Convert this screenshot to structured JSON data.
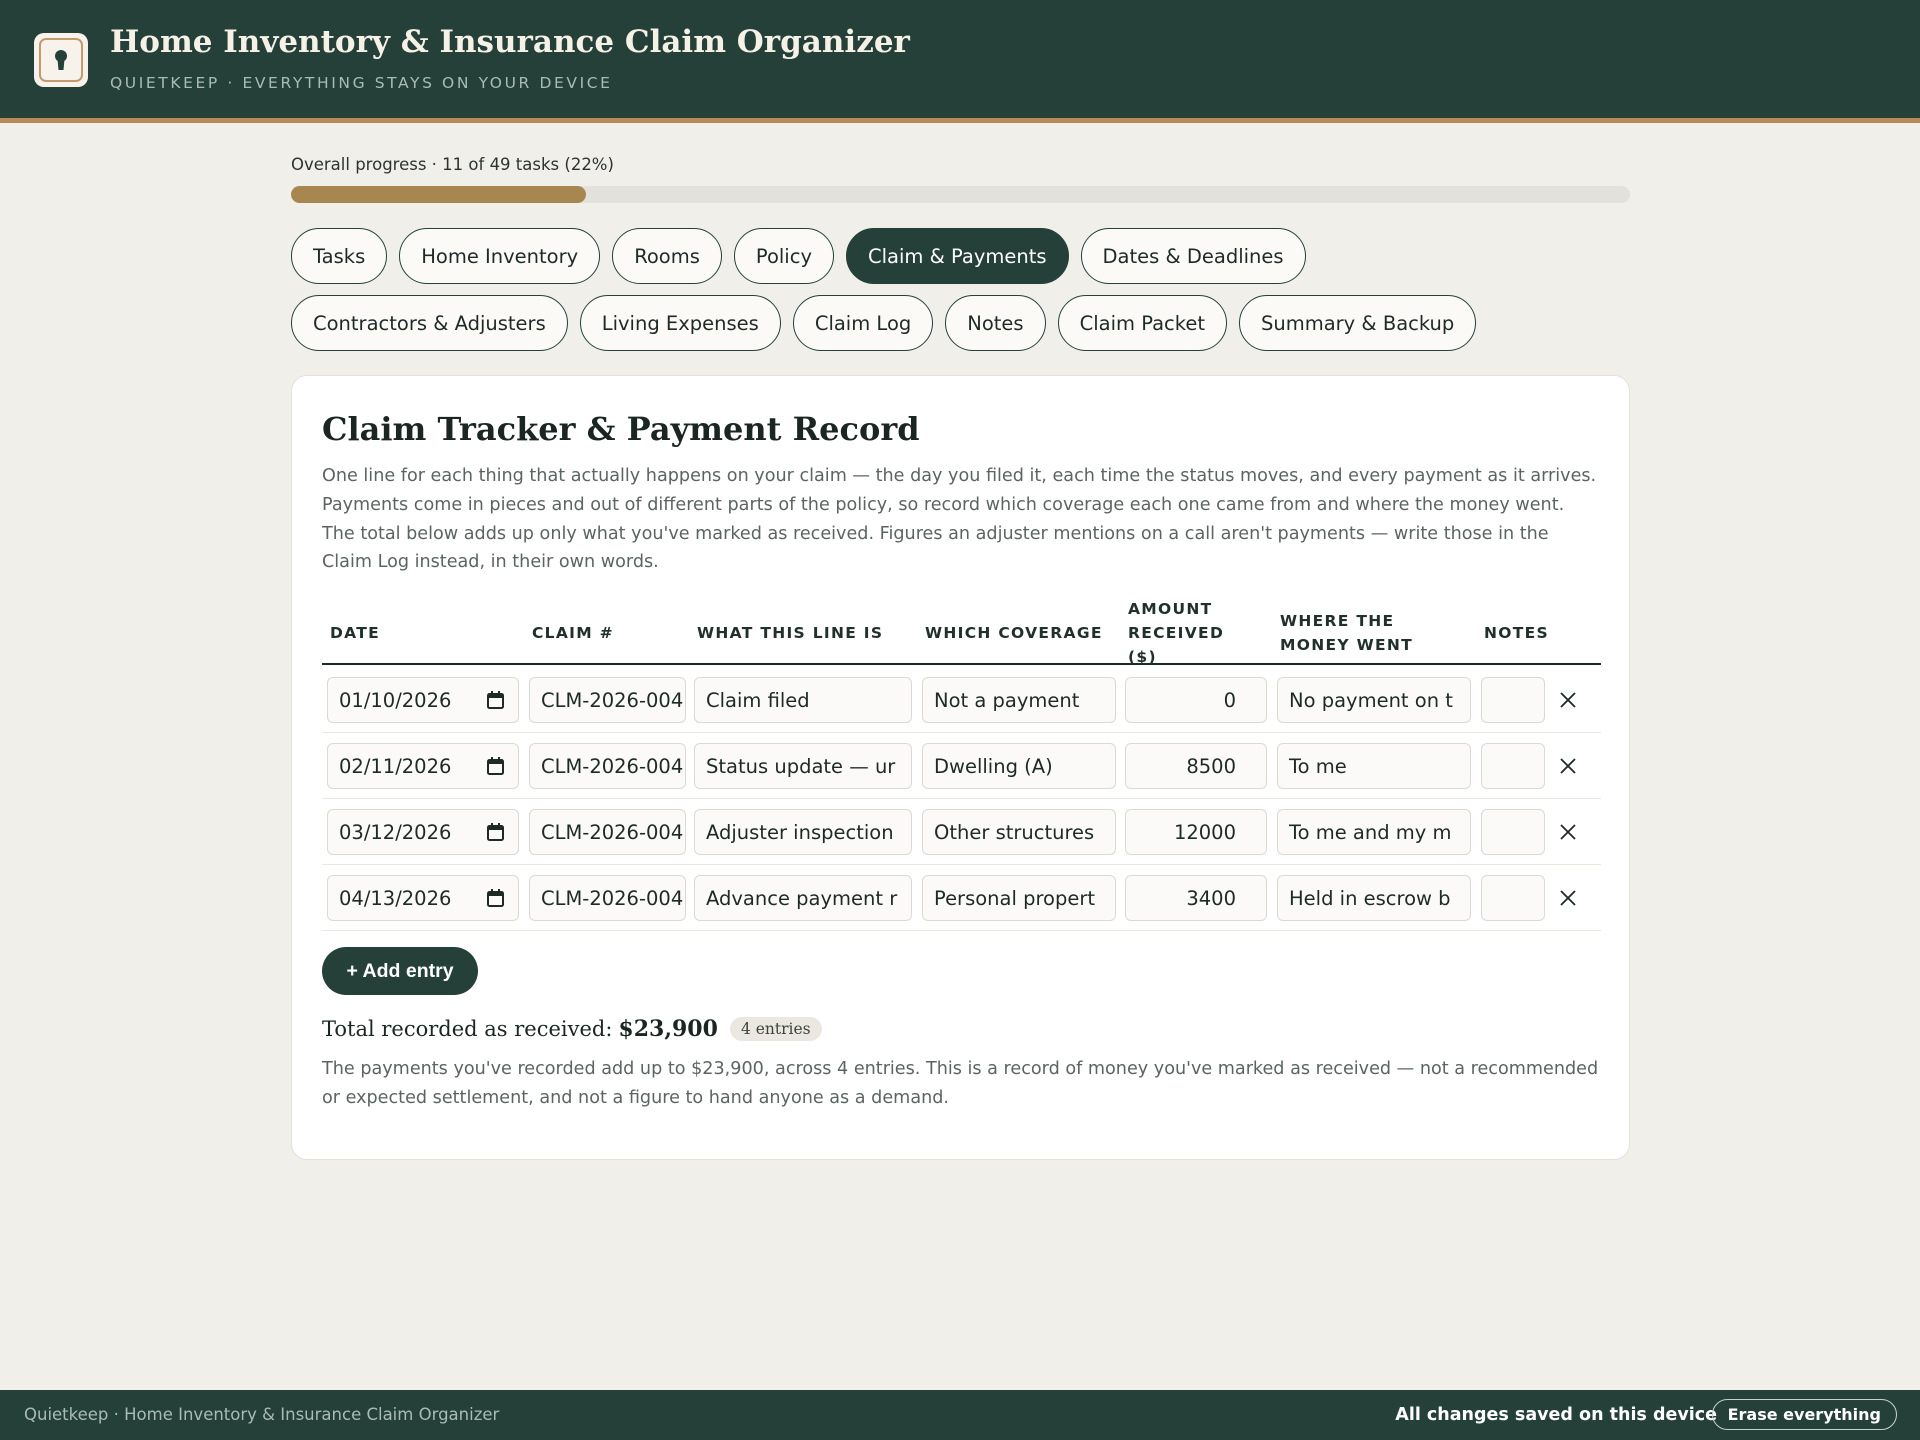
{
  "header": {
    "title": "Home Inventory & Insurance Claim Organizer",
    "subtitle": "QUIETKEEP · EVERYTHING STAYS ON YOUR DEVICE",
    "logo_icon": "keyhole-icon"
  },
  "progress": {
    "label": "Overall progress · 11 of 49 tasks (22%)",
    "completed": 11,
    "total": 49,
    "percent": 22
  },
  "tabs": [
    {
      "label": "Tasks",
      "active": false
    },
    {
      "label": "Home Inventory",
      "active": false
    },
    {
      "label": "Rooms",
      "active": false
    },
    {
      "label": "Policy",
      "active": false
    },
    {
      "label": "Claim & Payments",
      "active": true
    },
    {
      "label": "Dates & Deadlines",
      "active": false
    },
    {
      "label": "Contractors & Adjusters",
      "active": false
    },
    {
      "label": "Living Expenses",
      "active": false
    },
    {
      "label": "Claim Log",
      "active": false
    },
    {
      "label": "Notes",
      "active": false
    },
    {
      "label": "Claim Packet",
      "active": false
    },
    {
      "label": "Summary & Backup",
      "active": false
    }
  ],
  "section": {
    "title": "Claim Tracker & Payment Record",
    "description": "One line for each thing that actually happens on your claim — the day you filed it, each time the status moves, and every payment as it arrives. Payments come in pieces and out of different parts of the policy, so record which coverage each one came from and where the money went. The total below adds up only what you've marked as received. Figures an adjuster mentions on a call aren't payments — write those in the Claim Log instead, in their own words."
  },
  "table": {
    "headers": {
      "date": "DATE",
      "claim": "CLAIM #",
      "what": "WHAT THIS LINE IS",
      "coverage": "WHICH COVERAGE",
      "amount": "AMOUNT RECEIVED ($)",
      "where": "WHERE THE MONEY WENT",
      "notes": "NOTES"
    },
    "rows": [
      {
        "date": "01/10/2026",
        "claim": "CLM-2026-004",
        "what": "Claim filed",
        "coverage": "Not a payment",
        "amount": "0",
        "where": "No payment on t",
        "notes": ""
      },
      {
        "date": "02/11/2026",
        "claim": "CLM-2026-004",
        "what": "Status update — ur",
        "coverage": "Dwelling (A)",
        "amount": "8500",
        "where": "To me",
        "notes": ""
      },
      {
        "date": "03/12/2026",
        "claim": "CLM-2026-004",
        "what": "Adjuster inspection",
        "coverage": "Other structures",
        "amount": "12000",
        "where": "To me and my m",
        "notes": ""
      },
      {
        "date": "04/13/2026",
        "claim": "CLM-2026-004",
        "what": "Advance payment r",
        "coverage": "Personal propert",
        "amount": "3400",
        "where": "Held in escrow b",
        "notes": ""
      }
    ]
  },
  "add_button": "+ Add entry",
  "totals": {
    "label": "Total recorded as received:",
    "amount": "$23,900",
    "badge": "4 entries",
    "note": "The payments you've recorded add up to $23,900, across 4 entries. This is a record of money you've marked as received — not a recommended or expected settlement, and not a figure to hand anyone as a demand."
  },
  "footer": {
    "left": "Quietkeep · Home Inventory & Insurance Claim Organizer",
    "status": "All changes saved on this device",
    "erase_button": "Erase everything"
  },
  "colors": {
    "brand": "#254039",
    "accent": "#b68a57",
    "progress": "#a8864f",
    "background": "#f1efea"
  }
}
